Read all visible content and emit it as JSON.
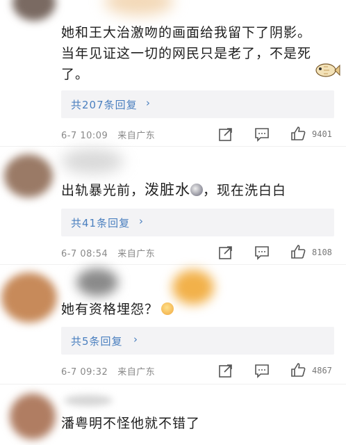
{
  "comments": [
    {
      "text_lines": [
        "她和王大治激吻的画面给我留下了阴影。",
        "当年见证这一切的网民只是老了，不是死",
        "了。"
      ],
      "replies_label": "共207条回复",
      "date": "6-7 10:09",
      "source": "来自广东",
      "likes": "9401"
    },
    {
      "text_before": "出轨暴光前，",
      "text_emph": "泼脏水",
      "text_after": "，现在洗白白",
      "replies_label": "共41条回复",
      "date": "6-7 08:54",
      "source": "来自广东",
      "likes": "8108"
    },
    {
      "text": "她有资格埋怨？",
      "replies_label": "共5条回复",
      "date": "6-7 09:32",
      "source": "来自广东",
      "likes": "4867"
    },
    {
      "text": "潘粤明不怪他就不错了"
    }
  ],
  "chevron": "›",
  "icons": {
    "share": "share-icon",
    "comment": "comment-icon",
    "like": "like-icon"
  }
}
